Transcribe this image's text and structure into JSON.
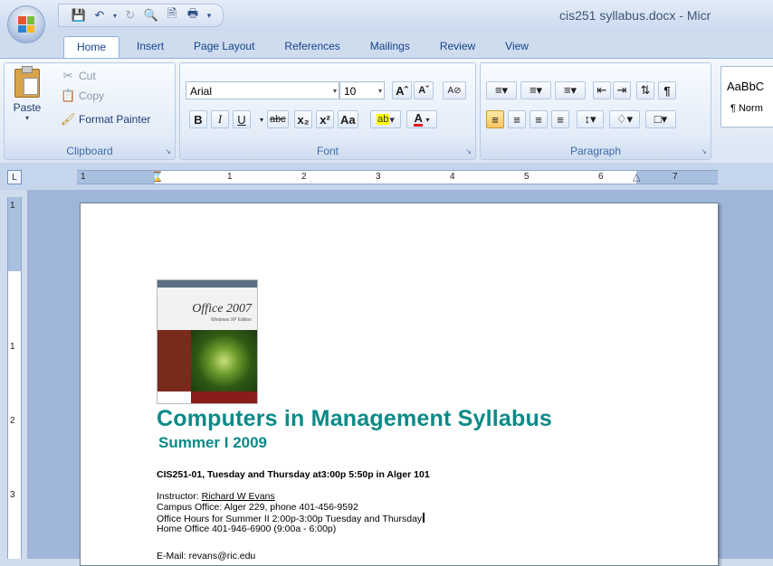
{
  "window": {
    "title": "cis251 syllabus.docx - Micr"
  },
  "tabs": [
    "Home",
    "Insert",
    "Page Layout",
    "References",
    "Mailings",
    "Review",
    "View"
  ],
  "ribbon": {
    "clipboard": {
      "label": "Clipboard",
      "paste": "Paste",
      "cut": "Cut",
      "copy": "Copy",
      "format_painter": "Format Painter"
    },
    "font": {
      "label": "Font",
      "font_name": "Arial",
      "font_size": "10"
    },
    "paragraph": {
      "label": "Paragraph"
    },
    "styles": {
      "sample": "AaBbC",
      "name": "¶ Norm"
    }
  },
  "ruler": {
    "numbers": [
      "1",
      "1",
      "2",
      "3",
      "4",
      "5",
      "6",
      "7"
    ]
  },
  "vruler": {
    "numbers": [
      "1",
      "2",
      "3"
    ]
  },
  "document": {
    "cover": {
      "title": "Office 2007",
      "subtitle": "Windows XP Edition"
    },
    "heading": "Computers in Management  Syllabus",
    "subheading": "Summer I 2009",
    "course_line": "CIS251-01, Tuesday and Thursday at3:00p 5:50p in Alger 101",
    "instructor_label": "Instructor: ",
    "instructor_name": "Richard W Evans",
    "campus_office": "Campus Office: Alger 229, phone 401-456-9592",
    "office_hours": "Office Hours for Summer II 2:00p-3:00p Tuesday  and Thursday",
    "home_office": "Home Office 401-946-6900 (9:00a - 6:00p)",
    "email": "E-Mail: revans@ric.edu"
  },
  "colors": {
    "heading": "#0b8a87",
    "ribbon_label": "#3e6aaa"
  }
}
